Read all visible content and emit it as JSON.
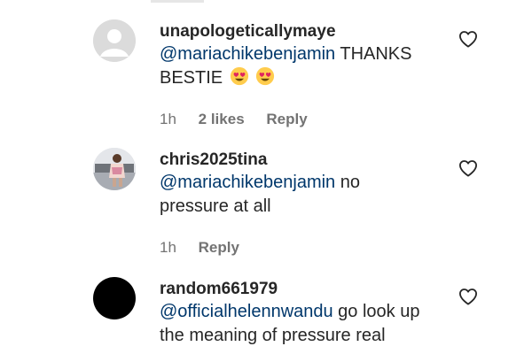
{
  "comments": [
    {
      "username": "unapologeticallymaye",
      "mention": "@mariachikebenjamin",
      "text": " THANKS BESTIE",
      "emoji": "heart-eyes-emoji",
      "time": "1h",
      "likes": "2 likes",
      "reply": "Reply",
      "avatar": "default-avatar"
    },
    {
      "username": "chris2025tina",
      "mention": "@mariachikebenjamin",
      "text": " no pressure at all",
      "time": "1h",
      "reply": "Reply",
      "avatar": "photo-avatar"
    },
    {
      "username": "random661979",
      "mention": "@officialhelennwandu",
      "text": " go look up the meaning of pressure real",
      "avatar": "black-avatar"
    }
  ],
  "colors": {
    "text": "#262626",
    "mention": "#00376b",
    "meta": "#737373"
  },
  "icons": {
    "like": "heart-outline-icon"
  }
}
